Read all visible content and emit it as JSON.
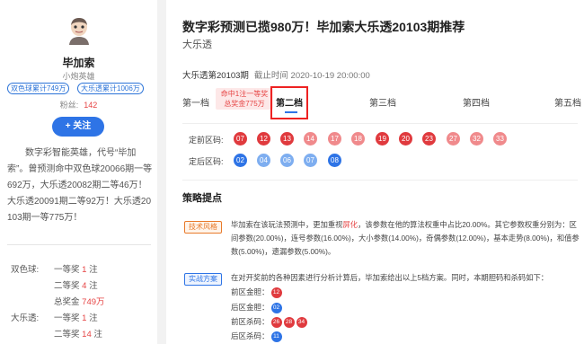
{
  "author": {
    "name": "毕加索",
    "subtitle": "小炮英雄",
    "tags": [
      "双色球累计749万",
      "大乐透累计1006万"
    ],
    "fans_label": "粉丝:",
    "fans_count": "142",
    "follow_label": "+ 关注",
    "bio": "数字彩智能英雄，代号“毕加索”。曾预测命中双色球20066期一等692万，大乐透20082期二等46万！大乐透20091期二等92万！大乐透20103期一等775万！",
    "records": [
      {
        "game": "双色球:",
        "prize": "一等奖",
        "count": "1",
        "unit": "注"
      },
      {
        "game": "",
        "prize": "二等奖",
        "count": "4",
        "unit": "注"
      },
      {
        "game": "",
        "prize": "总奖金",
        "count": "749万",
        "unit": ""
      },
      {
        "game": "大乐透:",
        "prize": "一等奖",
        "count": "1",
        "unit": "注"
      },
      {
        "game": "",
        "prize": "二等奖",
        "count": "14",
        "unit": "注"
      }
    ]
  },
  "article": {
    "title": "数字彩预测已揽980万！毕加索大乐透20103期推荐",
    "subtitle": "大乐透",
    "issue": "大乐透第20103期",
    "deadline": "截止时间  2020-10-19 20:00:00",
    "hit_badge": [
      "命中1注一等奖",
      "总奖金775万"
    ]
  },
  "tabs": [
    "第一档",
    "第二档",
    "第三档",
    "第四档",
    "第五档"
  ],
  "front_label": "定前区码:",
  "back_label": "定后区码:",
  "front_balls": [
    "07",
    "12",
    "13",
    "14",
    "17",
    "18",
    "19",
    "20",
    "23",
    "27",
    "32",
    "33"
  ],
  "back_balls": [
    "02",
    "04",
    "06",
    "07",
    "08"
  ],
  "strategy": {
    "title": "策略提点",
    "chip1": "技术风格",
    "para1_a": "毕加索在该玩法预测中，更加重视",
    "para1_hl": "屏化",
    "para1_b": "，该参数在他的算法权重中占比20.00%。其它参数权重分别为：区间参数(20.00%)，连号参数(16.00%)，大小参数(14.00%)，奇偶参数(12.00%)，基本走势(8.00%)，和值参数(5.00%)，遗漏参数(5.00%)。",
    "chip2": "实战方案",
    "para2": "在对开奖前的各种因素进行分析计算后，毕加索给出以上5档方案。同时，本期胆码和杀码如下：",
    "kv": [
      {
        "label": "前区金胆：",
        "balls": [
          "12"
        ],
        "color": "red"
      },
      {
        "label": "后区金胆：",
        "balls": [
          "02"
        ],
        "color": "blue"
      },
      {
        "label": "前区杀码：",
        "balls": [
          "26",
          "28",
          "34"
        ],
        "color": "red"
      },
      {
        "label": "后区杀码：",
        "balls": [
          "11"
        ],
        "color": "blue"
      }
    ]
  }
}
